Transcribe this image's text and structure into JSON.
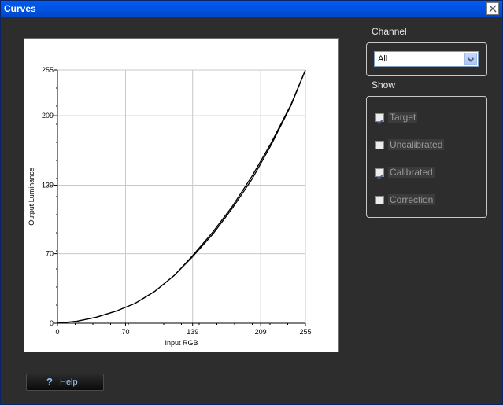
{
  "window": {
    "title": "Curves"
  },
  "channel": {
    "heading": "Channel",
    "selected": "All"
  },
  "show": {
    "heading": "Show",
    "options": [
      {
        "label": "Target",
        "checked": true
      },
      {
        "label": "Uncalibrated",
        "checked": false
      },
      {
        "label": "Calibrated",
        "checked": true
      },
      {
        "label": "Correction",
        "checked": false
      }
    ]
  },
  "help": {
    "label": "Help"
  },
  "chart_data": {
    "type": "line",
    "xlabel": "Input RGB",
    "ylabel": "Output Luminance",
    "x_ticks": [
      0,
      70,
      139,
      209,
      255
    ],
    "y_ticks": [
      0,
      70,
      139,
      209,
      255
    ],
    "xlim": [
      0,
      255
    ],
    "ylim": [
      0,
      255
    ],
    "grid": true,
    "series": [
      {
        "x": [
          0,
          20,
          40,
          60,
          80,
          100,
          120,
          139,
          160,
          180,
          200,
          220,
          240,
          255
        ],
        "y": [
          0,
          2,
          6,
          12,
          20,
          32,
          48,
          68,
          92,
          118,
          148,
          182,
          220,
          255
        ]
      },
      {
        "x": [
          0,
          20,
          40,
          60,
          80,
          100,
          120,
          139,
          160,
          180,
          200,
          220,
          240,
          255
        ],
        "y": [
          0,
          2,
          6,
          12,
          20,
          32,
          48,
          67,
          90,
          116,
          145,
          180,
          219,
          255
        ]
      }
    ]
  }
}
